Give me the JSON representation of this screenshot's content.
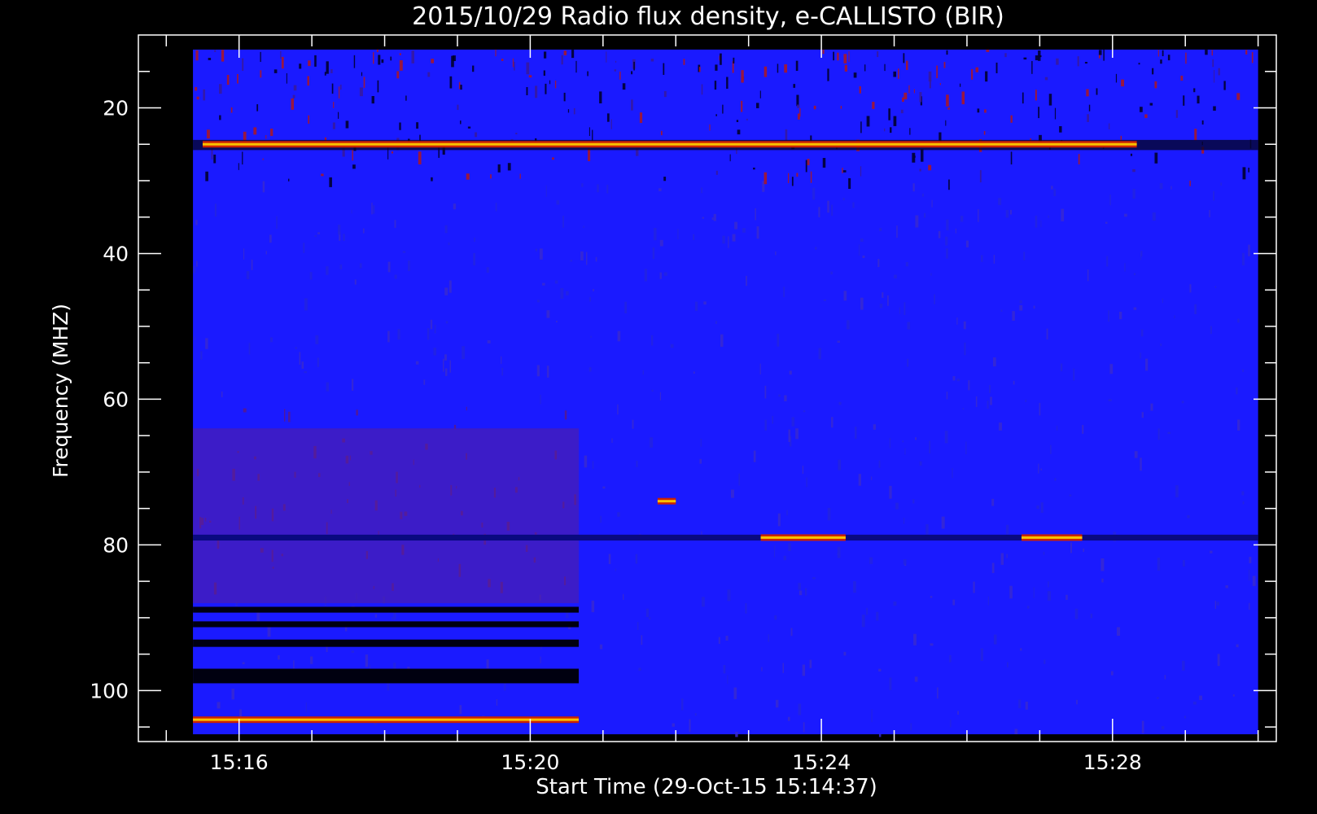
{
  "chart_data": {
    "type": "heatmap",
    "title": "2015/10/29  Radio flux density, e-CALLISTO (BIR)",
    "xlabel": "Start Time (29-Oct-15 15:14:37)",
    "ylabel": "Frequency (MHZ)",
    "x_tick_labels": [
      "15:16",
      "15:20",
      "15:24",
      "15:28"
    ],
    "y_tick_labels": [
      "20",
      "40",
      "60",
      "80",
      "100"
    ],
    "y_ticks": [
      20,
      40,
      60,
      80,
      100
    ],
    "y_inverted": true,
    "xlim": [
      "15:14:37",
      "15:30:15"
    ],
    "ylim": [
      10,
      107
    ],
    "data_extent": {
      "time_start": "15:15:22",
      "time_end": "15:30:00",
      "freq_min": 12,
      "freq_max": 106
    },
    "grid": false,
    "features": [
      {
        "label": "band",
        "freq": 25,
        "t_start": "15:15:30",
        "t_end": "15:28:20",
        "level": "bright"
      },
      {
        "label": "band",
        "freq": 79,
        "t_start": "15:23:10",
        "t_end": "15:24:20",
        "level": "bright"
      },
      {
        "label": "band",
        "freq": 79,
        "t_start": "15:26:45",
        "t_end": "15:27:35",
        "level": "bright"
      },
      {
        "label": "band",
        "freq": 104,
        "t_start": "15:15:22",
        "t_end": "15:20:40",
        "level": "bright"
      },
      {
        "label": "burst",
        "freq": 74,
        "t_start": "15:21:45",
        "t_end": "15:22:00",
        "level": "bright"
      }
    ],
    "colors": {
      "background": "#000000",
      "base": "#1a1aff",
      "mid": "#cc2200",
      "high": "#ffdd00"
    }
  }
}
